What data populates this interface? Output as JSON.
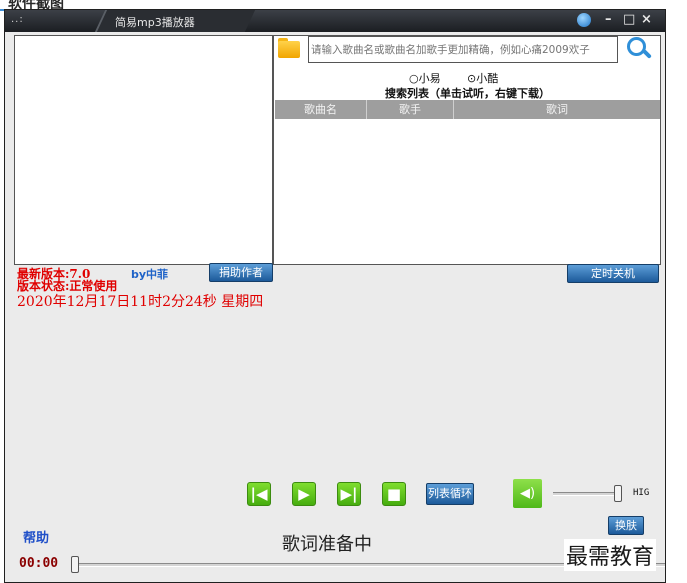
{
  "page_caption": "软件截图",
  "window": {
    "title": "简易mp3播放器",
    "app_icon": "..:",
    "controls": {
      "skin": "skin-icon",
      "minimize": "–",
      "restore": "□",
      "close": "×"
    }
  },
  "search": {
    "placeholder": "请输入歌曲名或歌曲名加歌手更加精确，例如心痛2009欢子",
    "value": "",
    "sources": [
      {
        "label": "小易",
        "selected": false
      },
      {
        "label": "小酷",
        "selected": true
      }
    ],
    "radio_glyphs": {
      "selected": "⊙",
      "unselected": "○"
    },
    "list_label": "搜索列表（单击试听，右键下载）",
    "columns": [
      "歌曲名",
      "歌手",
      "歌词"
    ]
  },
  "info": {
    "version": "最新版本:7.0",
    "author": "by中菲",
    "status": "版本状态:正常使用",
    "datetime": "2020年12月17日11时2分24秒  星期四"
  },
  "buttons": {
    "donate": "捐助作者",
    "timer_off": "定时关机",
    "loop_mode": "列表循环",
    "skin": "换肤"
  },
  "player": {
    "prev_glyph": "|◀",
    "play_glyph": "▶",
    "next_glyph": "▶|",
    "stop_glyph": "■",
    "volume_glyph": "◀)",
    "volume_label": "HIG",
    "volume_level": 0.98,
    "help": "帮助",
    "lyrics_status": "歌词准备中",
    "current_time": "00:00",
    "progress": 0.0
  },
  "watermark": "最需教育",
  "colors": {
    "accent_blue": "#1c5a9a",
    "status_red": "#e00000",
    "control_green": "#46ad0f"
  }
}
